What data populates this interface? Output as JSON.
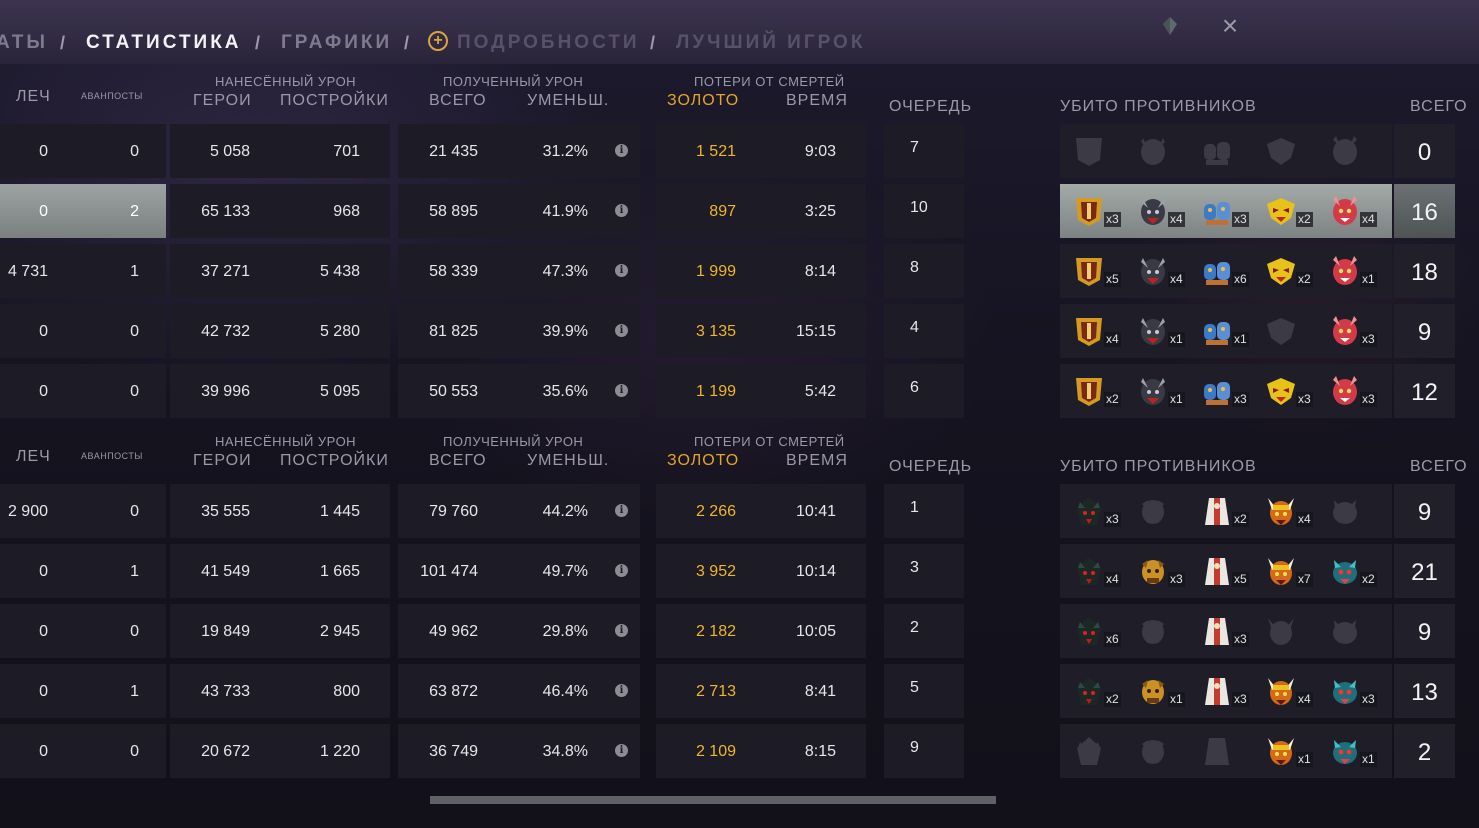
{
  "nav": {
    "items": [
      {
        "label": "АТЫ",
        "state": "normal"
      },
      {
        "label": "СТАТИСТИКА",
        "state": "active"
      },
      {
        "label": "ГРАФИКИ",
        "state": "normal"
      },
      {
        "label": "ПОДРОБНОСТИ",
        "state": "dim"
      },
      {
        "label": "ЛУЧШИЙ ИГРОК",
        "state": "dim"
      }
    ],
    "separator": "/"
  },
  "headers": {
    "heal": "ЛЕЧ",
    "outposts": "АВАНПОСТЫ",
    "damage_dealt": "НАНЕСЁННЫЙ УРОН",
    "heroes": "ГЕРОИ",
    "buildings": "ПОСТРОЙКИ",
    "damage_taken": "ПОЛУЧЕННЫЙ УРОН",
    "total": "ВСЕГО",
    "reduced": "УМЕНЬШ.",
    "death_losses": "ПОТЕРИ ОТ СМЕРТЕЙ",
    "gold": "ЗОЛОТО",
    "time": "ВРЕМЯ",
    "queue": "ОЧЕРЕДЬ",
    "enemies_killed": "УБИТО ПРОТИВНИКОВ",
    "kills_total": "ВСЕГО"
  },
  "colors": {
    "accent_gold": "#efb62b",
    "selected_row": "#8d9392",
    "panel": "#1d1b26"
  },
  "teams": [
    {
      "rows": [
        {
          "heal": "0",
          "outposts": "0",
          "hero_dmg": "5 058",
          "building_dmg": "701",
          "taken_total": "21 435",
          "taken_reduced": "31.2%",
          "gold_lost": "1 521",
          "time_dead": "9:03",
          "queue": "7",
          "kills": [
            {
              "icon": "hero-shield-icon",
              "x": ""
            },
            {
              "icon": "hero-dark-icon",
              "x": ""
            },
            {
              "icon": "hero-ogre-icon",
              "x": ""
            },
            {
              "icon": "hero-mask-icon",
              "x": ""
            },
            {
              "icon": "hero-demon-icon",
              "x": ""
            }
          ],
          "kills_total": "0",
          "selected": false
        },
        {
          "heal": "0",
          "outposts": "2",
          "hero_dmg": "65 133",
          "building_dmg": "968",
          "taken_total": "58 895",
          "taken_reduced": "41.9%",
          "gold_lost": "897",
          "time_dead": "3:25",
          "queue": "10",
          "kills": [
            {
              "icon": "hero-shield-icon",
              "x": "x3"
            },
            {
              "icon": "hero-dark-icon",
              "x": "x4"
            },
            {
              "icon": "hero-ogre-icon",
              "x": "x3"
            },
            {
              "icon": "hero-mask-icon",
              "x": "x2"
            },
            {
              "icon": "hero-demon-icon",
              "x": "x4"
            }
          ],
          "kills_total": "16",
          "selected": true
        },
        {
          "heal": "4 731",
          "outposts": "1",
          "hero_dmg": "37 271",
          "building_dmg": "5 438",
          "taken_total": "58 339",
          "taken_reduced": "47.3%",
          "gold_lost": "1 999",
          "time_dead": "8:14",
          "queue": "8",
          "kills": [
            {
              "icon": "hero-shield-icon",
              "x": "x5"
            },
            {
              "icon": "hero-dark-icon",
              "x": "x4"
            },
            {
              "icon": "hero-ogre-icon",
              "x": "x6"
            },
            {
              "icon": "hero-mask-icon",
              "x": "x2"
            },
            {
              "icon": "hero-demon-icon",
              "x": "x1"
            }
          ],
          "kills_total": "18",
          "selected": false
        },
        {
          "heal": "0",
          "outposts": "0",
          "hero_dmg": "42 732",
          "building_dmg": "5 280",
          "taken_total": "81 825",
          "taken_reduced": "39.9%",
          "gold_lost": "3 135",
          "time_dead": "15:15",
          "queue": "4",
          "kills": [
            {
              "icon": "hero-shield-icon",
              "x": "x4"
            },
            {
              "icon": "hero-dark-icon",
              "x": "x1"
            },
            {
              "icon": "hero-ogre-icon",
              "x": "x1"
            },
            {
              "icon": "hero-mask-icon",
              "x": ""
            },
            {
              "icon": "hero-demon-icon",
              "x": "x3"
            }
          ],
          "kills_total": "9",
          "selected": false
        },
        {
          "heal": "0",
          "outposts": "0",
          "hero_dmg": "39 996",
          "building_dmg": "5 095",
          "taken_total": "50 553",
          "taken_reduced": "35.6%",
          "gold_lost": "1 199",
          "time_dead": "5:42",
          "queue": "6",
          "kills": [
            {
              "icon": "hero-shield-icon",
              "x": "x2"
            },
            {
              "icon": "hero-dark-icon",
              "x": "x1"
            },
            {
              "icon": "hero-ogre-icon",
              "x": "x3"
            },
            {
              "icon": "hero-mask-icon",
              "x": "x3"
            },
            {
              "icon": "hero-demon-icon",
              "x": "x3"
            }
          ],
          "kills_total": "12",
          "selected": false
        }
      ]
    },
    {
      "rows": [
        {
          "heal": "2 900",
          "outposts": "0",
          "hero_dmg": "35 555",
          "building_dmg": "1 445",
          "taken_total": "79 760",
          "taken_reduced": "44.2%",
          "gold_lost": "2 266",
          "time_dead": "10:41",
          "queue": "1",
          "kills": [
            {
              "icon": "hero-shadow-icon",
              "x": "x3"
            },
            {
              "icon": "hero-beast-icon",
              "x": ""
            },
            {
              "icon": "hero-robe-icon",
              "x": "x2"
            },
            {
              "icon": "hero-horned-icon",
              "x": "x4"
            },
            {
              "icon": "hero-bug-icon",
              "x": ""
            }
          ],
          "kills_total": "9",
          "selected": false
        },
        {
          "heal": "0",
          "outposts": "1",
          "hero_dmg": "41 549",
          "building_dmg": "1 665",
          "taken_total": "101 474",
          "taken_reduced": "49.7%",
          "gold_lost": "3 952",
          "time_dead": "10:14",
          "queue": "3",
          "kills": [
            {
              "icon": "hero-shadow-icon",
              "x": "x4"
            },
            {
              "icon": "hero-beast-icon",
              "x": "x3"
            },
            {
              "icon": "hero-robe-icon",
              "x": "x5"
            },
            {
              "icon": "hero-horned-icon",
              "x": "x7"
            },
            {
              "icon": "hero-bug-icon",
              "x": "x2"
            }
          ],
          "kills_total": "21",
          "selected": false
        },
        {
          "heal": "0",
          "outposts": "0",
          "hero_dmg": "19 849",
          "building_dmg": "2 945",
          "taken_total": "49 962",
          "taken_reduced": "29.8%",
          "gold_lost": "2 182",
          "time_dead": "10:05",
          "queue": "2",
          "kills": [
            {
              "icon": "hero-shadow-icon",
              "x": "x6"
            },
            {
              "icon": "hero-beast-icon",
              "x": ""
            },
            {
              "icon": "hero-robe-icon",
              "x": "x3"
            },
            {
              "icon": "hero-horned-icon",
              "x": ""
            },
            {
              "icon": "hero-bug-icon",
              "x": ""
            }
          ],
          "kills_total": "9",
          "selected": false
        },
        {
          "heal": "0",
          "outposts": "1",
          "hero_dmg": "43 733",
          "building_dmg": "800",
          "taken_total": "63 872",
          "taken_reduced": "46.4%",
          "gold_lost": "2 713",
          "time_dead": "8:41",
          "queue": "5",
          "kills": [
            {
              "icon": "hero-shadow-icon",
              "x": "x2"
            },
            {
              "icon": "hero-beast-icon",
              "x": "x1"
            },
            {
              "icon": "hero-robe-icon",
              "x": "x3"
            },
            {
              "icon": "hero-horned-icon",
              "x": "x4"
            },
            {
              "icon": "hero-bug-icon",
              "x": "x3"
            }
          ],
          "kills_total": "13",
          "selected": false
        },
        {
          "heal": "0",
          "outposts": "0",
          "hero_dmg": "20 672",
          "building_dmg": "1 220",
          "taken_total": "36 749",
          "taken_reduced": "34.8%",
          "gold_lost": "2 109",
          "time_dead": "8:15",
          "queue": "9",
          "kills": [
            {
              "icon": "hero-shadow-icon",
              "x": ""
            },
            {
              "icon": "hero-beast-icon",
              "x": ""
            },
            {
              "icon": "hero-robe-icon",
              "x": ""
            },
            {
              "icon": "hero-horned-icon",
              "x": "x1"
            },
            {
              "icon": "hero-bug-icon",
              "x": "x1"
            }
          ],
          "kills_total": "2",
          "selected": false
        }
      ]
    }
  ]
}
